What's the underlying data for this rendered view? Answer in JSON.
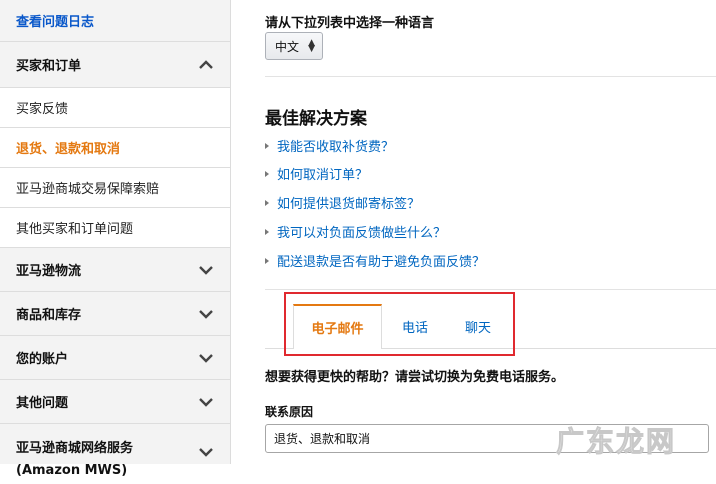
{
  "sidebar": {
    "top_link": "查看问题日志",
    "section_orders": "买家和订单",
    "sub_items": [
      "买家反馈",
      "退货、退款和取消",
      "亚马逊商城交易保障索赔",
      "其他买家和订单问题"
    ],
    "sections": [
      "亚马逊物流",
      "商品和库存",
      "您的账户",
      "其他问题",
      "亚马逊商城网络服务(Amazon MWS)"
    ]
  },
  "main": {
    "language_label": "请从下拉列表中选择一种语言",
    "language_value": "中文",
    "best_title": "最佳解决方案",
    "faqs": [
      "我能否收取补货费？",
      "如何取消订单？",
      "如何提供退货邮寄标签？",
      "我可以对负面反馈做些什么？",
      "配送退款是否有助于避免负面反馈？"
    ],
    "tabs": [
      "电子邮件",
      "电话",
      "聊天"
    ],
    "hint": "想要获得更快的帮助？请尝试切换为免费电话服务。",
    "reason_label": "联系原因",
    "reason_value": "退货、退款和取消"
  },
  "watermark": "广东龙网",
  "colors": {
    "accent": "#e47911",
    "link": "#0066c0",
    "highlight": "#e0292f"
  }
}
